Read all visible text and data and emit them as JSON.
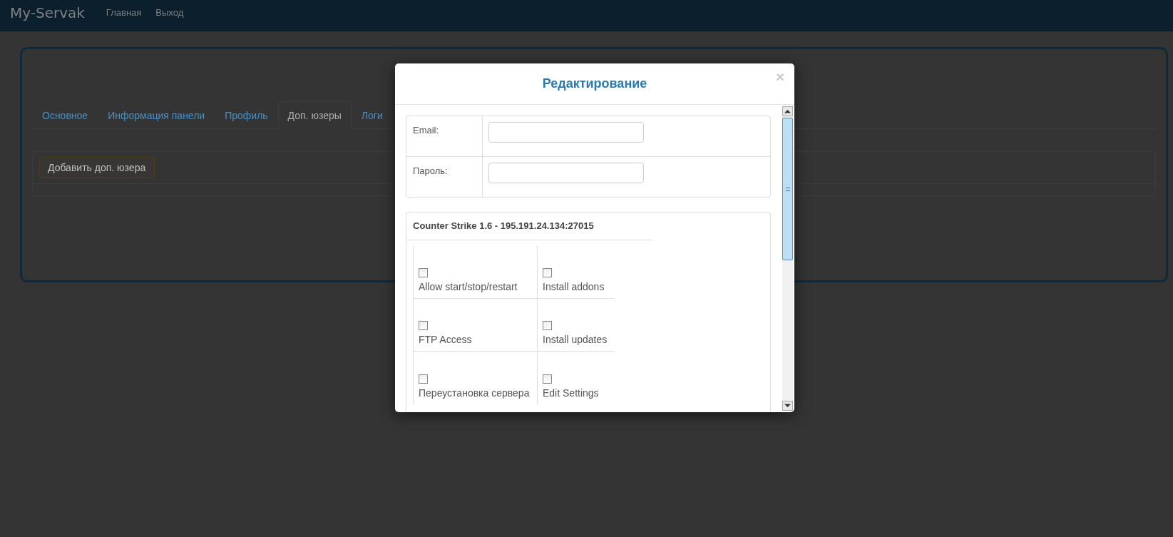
{
  "navbar": {
    "brand": "My-Servak",
    "links": [
      "Главная",
      "Выход"
    ]
  },
  "tabs": [
    {
      "label": "Основное",
      "selected": false
    },
    {
      "label": "Информация панели",
      "selected": false
    },
    {
      "label": "Профиль",
      "selected": false
    },
    {
      "label": "Доп. юзеры",
      "selected": true
    },
    {
      "label": "Логи",
      "selected": false
    }
  ],
  "add_button": "Добавить доп. юзера",
  "modal": {
    "title": "Редактирование",
    "close": "×",
    "fields": [
      {
        "label": "Email:"
      },
      {
        "label": "Пароль:"
      }
    ],
    "server": {
      "title": "Counter Strike 1.6 - 195.191.24.134:27015",
      "permissions": [
        {
          "label": "Allow start/stop/restart",
          "checked": false
        },
        {
          "label": "Install addons",
          "checked": false
        },
        {
          "label": "FTP Access",
          "checked": false
        },
        {
          "label": "Install updates",
          "checked": false
        },
        {
          "label": "Переустановка сервера",
          "checked": false
        },
        {
          "label": "Edit Settings",
          "checked": false
        }
      ]
    }
  }
}
